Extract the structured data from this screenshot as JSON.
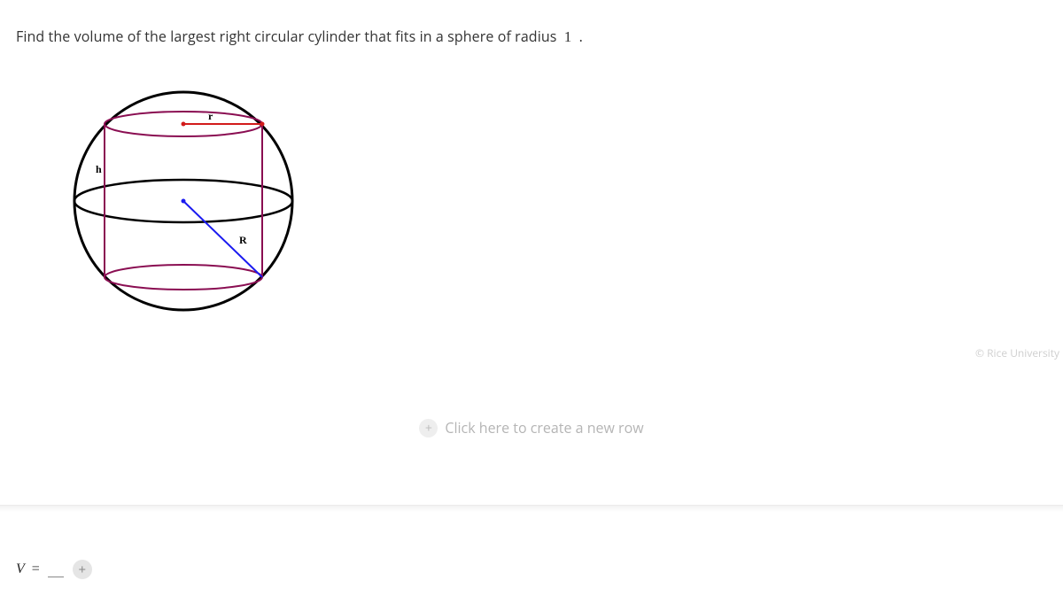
{
  "question": {
    "prefix": "Find the volume of the largest right circular cylinder that fits in a sphere of radius",
    "radius_value": "1",
    "suffix": "."
  },
  "diagram": {
    "label_r": "r",
    "label_h": "h",
    "label_R": "R"
  },
  "copyright": "© Rice University",
  "new_row": {
    "label": "Click here to create a new row",
    "plus": "+"
  },
  "answer": {
    "symbol": "V",
    "equals": "=",
    "value": "",
    "add_plus": "+"
  }
}
